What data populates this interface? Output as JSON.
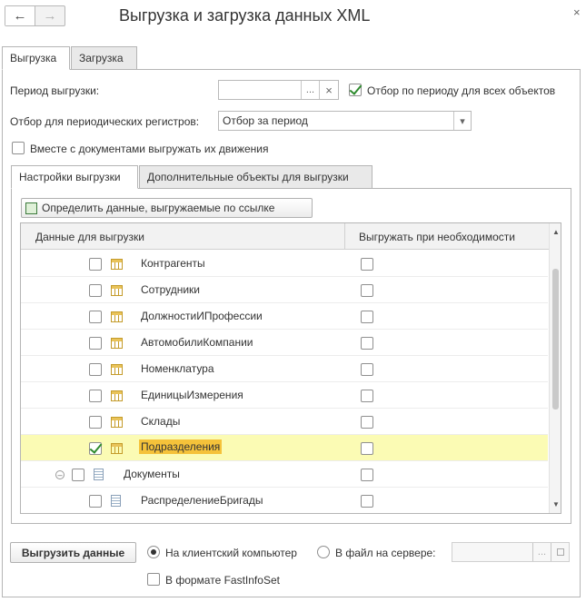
{
  "window": {
    "title": "Выгрузка и загрузка данных XML",
    "nav_back": "←",
    "nav_forward": "→",
    "close": "×"
  },
  "tabs": [
    "Выгрузка",
    "Загрузка"
  ],
  "export": {
    "period_label": "Период выгрузки:",
    "period_value": "",
    "period_btn_more": "...",
    "period_btn_clear": "×",
    "filter_all_label": "Отбор по периоду для всех объектов",
    "filter_all_checked": true,
    "registers_label": "Отбор для периодических регистров:",
    "registers_value": "Отбор за период",
    "registers_dropdown": "▾",
    "with_movements_label": "Вместе с документами выгружать их движения",
    "with_movements_checked": false
  },
  "inner_tabs": [
    "Настройки выгрузки",
    "Дополнительные объекты для выгрузки"
  ],
  "define_button": "Определить данные, выгружаемые по ссылке",
  "table": {
    "col_data": "Данные для выгрузки",
    "col_if_needed": "Выгружать при необходимости",
    "rows": [
      {
        "name": "Контрагенты",
        "checked": false,
        "icon": "catalog-icon",
        "selected": false
      },
      {
        "name": "Сотрудники",
        "checked": false,
        "icon": "catalog-icon",
        "selected": false
      },
      {
        "name": "ДолжностиИПрофессии",
        "checked": false,
        "icon": "catalog-icon",
        "selected": false
      },
      {
        "name": "АвтомобилиКомпании",
        "checked": false,
        "icon": "catalog-icon",
        "selected": false
      },
      {
        "name": "Номенклатура",
        "checked": false,
        "icon": "catalog-icon",
        "selected": false
      },
      {
        "name": "ЕдиницыИзмерения",
        "checked": false,
        "icon": "catalog-icon",
        "selected": false
      },
      {
        "name": "Склады",
        "checked": false,
        "icon": "catalog-icon",
        "selected": false
      },
      {
        "name": "Подразделения",
        "checked": true,
        "icon": "catalog-icon",
        "selected": true
      },
      {
        "name": "Документы",
        "checked": false,
        "icon": "document-group-icon",
        "selected": false,
        "group": true
      },
      {
        "name": "РаспределениеБригады",
        "checked": false,
        "icon": "document-icon",
        "selected": false
      }
    ]
  },
  "bottom": {
    "export_button": "Выгрузить данные",
    "to_client_label": "На клиентский компьютер",
    "to_client_selected": true,
    "to_server_label": "В файл на сервере:",
    "to_server_selected": false,
    "server_path": "",
    "server_path_more": "...",
    "fastinfoset_label": "В формате FastInfoSet",
    "fastinfoset_checked": false
  }
}
